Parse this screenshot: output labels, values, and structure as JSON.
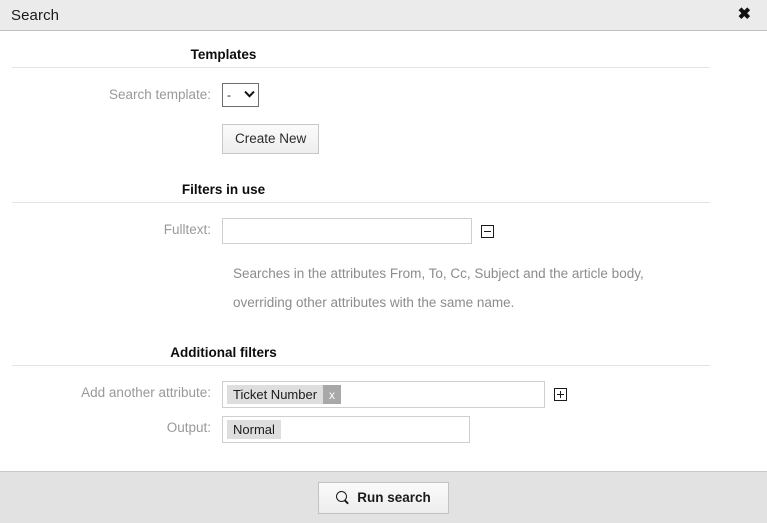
{
  "header": {
    "title": "Search",
    "close_icon": "close-icon",
    "close_glyph": "✖"
  },
  "sections": {
    "templates": {
      "title": "Templates",
      "search_template_label": "Search template:",
      "search_template_value": "-",
      "search_template_options": [
        "-"
      ],
      "chevron_icon": "chevron-down-icon",
      "chevron_glyph": "❯",
      "create_new_label": "Create New"
    },
    "filters_in_use": {
      "title": "Filters in use",
      "fulltext_label": "Fulltext:",
      "fulltext_value": "",
      "fulltext_placeholder": "",
      "remove_icon": "minus-box-icon",
      "hint_line_1": "Searches in the attributes From, To, Cc, Subject and the article body,",
      "hint_line_2": "overriding other attributes with the same name."
    },
    "additional_filters": {
      "title": "Additional filters",
      "add_attribute_label": "Add another attribute:",
      "add_attribute_token": "Ticket Number",
      "add_attribute_token_remove": "x",
      "add_icon": "plus-box-icon",
      "output_label": "Output:",
      "output_token": "Normal"
    }
  },
  "footer": {
    "run_search_label": "Run search",
    "search_icon": "magnifier-icon"
  },
  "colors": {
    "header_bg": "#ebebeb",
    "footer_bg": "#e2e2e2",
    "label_gray": "#999999",
    "hint_gray": "#8c8c8c",
    "token_bg": "#dedede",
    "token_x_bg": "#a8a8a8",
    "rule": "#e4e4e4"
  }
}
